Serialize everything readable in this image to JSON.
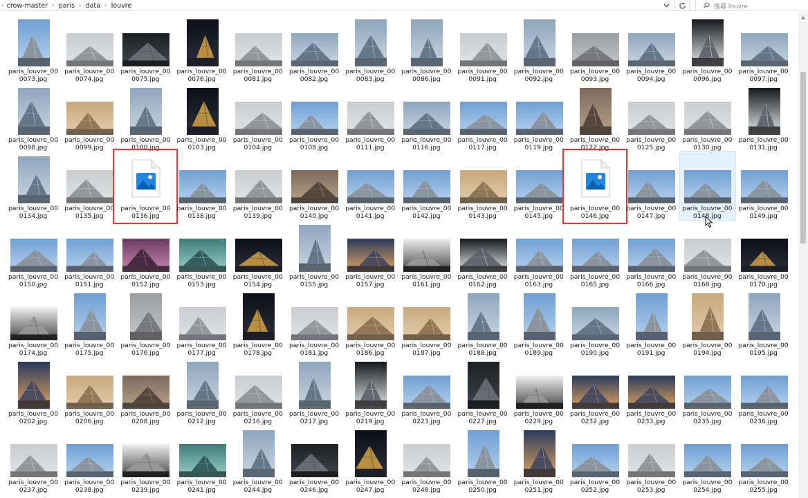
{
  "breadcrumbs": [
    "crow-master",
    "paris",
    "data",
    "louvre"
  ],
  "search": {
    "placeholder": "搜尋 louvre"
  },
  "icons": {
    "lead": "chevron-right-icon",
    "dropdown": "chevron-down-icon",
    "refresh": "refresh-icon",
    "search": "search-icon",
    "file": "image-file-icon",
    "cursor": "mouse-pointer-icon"
  },
  "colors": {
    "highlight_border": "#e03a3a",
    "hover_bg": "#e5f1fb",
    "file_icon_blue": "#1e88e5"
  },
  "rows": [
    [
      {
        "line1": "paris_louvre_00",
        "line2": "0073.jpg",
        "shape": "tall",
        "theme": "sky"
      },
      {
        "line1": "paris_louvre_00",
        "line2": "0074.jpg",
        "shape": "wide",
        "theme": "overcast"
      },
      {
        "line1": "paris_louvre_00",
        "line2": "0075.jpg",
        "shape": "wide",
        "theme": "dark"
      },
      {
        "line1": "paris_louvre_00",
        "line2": "0076.jpg",
        "shape": "tall",
        "theme": "night"
      },
      {
        "line1": "paris_louvre_00",
        "line2": "0081.jpg",
        "shape": "wide",
        "theme": "overcast"
      },
      {
        "line1": "paris_louvre_00",
        "line2": "0082.jpg",
        "shape": "wide",
        "theme": "glass"
      },
      {
        "line1": "paris_louvre_00",
        "line2": "0083.jpg",
        "shape": "tall",
        "theme": "glass"
      },
      {
        "line1": "paris_louvre_00",
        "line2": "0086.jpg",
        "shape": "tall",
        "theme": "glass"
      },
      {
        "line1": "paris_louvre_00",
        "line2": "0091.jpg",
        "shape": "wide",
        "theme": "overcast"
      },
      {
        "line1": "paris_louvre_00",
        "line2": "0092.jpg",
        "shape": "tall",
        "theme": "glass"
      },
      {
        "line1": "paris_louvre_00",
        "line2": "0093.jpg",
        "shape": "wide",
        "theme": "gray"
      },
      {
        "line1": "paris_louvre_00",
        "line2": "0094.jpg",
        "shape": "wide",
        "theme": "glass"
      },
      {
        "line1": "paris_louvre_00",
        "line2": "0096.jpg",
        "shape": "tall",
        "theme": "arch"
      },
      {
        "line1": "paris_louvre_00",
        "line2": "0097.jpg",
        "shape": "wide",
        "theme": "glass"
      }
    ],
    [
      {
        "line1": "paris_louvre_00",
        "line2": "0098.jpg",
        "shape": "tall",
        "theme": "glass"
      },
      {
        "line1": "paris_louvre_00",
        "line2": "0099.jpg",
        "shape": "wide",
        "theme": "warm"
      },
      {
        "line1": "paris_louvre_00",
        "line2": "0100.jpg",
        "shape": "tall",
        "theme": "glass"
      },
      {
        "line1": "paris_louvre_00",
        "line2": "0103.jpg",
        "shape": "tall",
        "theme": "night"
      },
      {
        "line1": "paris_louvre_00",
        "line2": "0104.jpg",
        "shape": "wide",
        "theme": "overcast"
      },
      {
        "line1": "paris_louvre_00",
        "line2": "0108.jpg",
        "shape": "wide",
        "theme": "sky"
      },
      {
        "line1": "paris_louvre_00",
        "line2": "0111.jpg",
        "shape": "wide",
        "theme": "overcast"
      },
      {
        "line1": "paris_louvre_00",
        "line2": "0116.jpg",
        "shape": "wide",
        "theme": "glass"
      },
      {
        "line1": "paris_louvre_00",
        "line2": "0117.jpg",
        "shape": "wide",
        "theme": "sky"
      },
      {
        "line1": "paris_louvre_00",
        "line2": "0119.jpg",
        "shape": "wide",
        "theme": "sky"
      },
      {
        "line1": "paris_louvre_00",
        "line2": "0122.jpg",
        "shape": "tall",
        "theme": "crowd"
      },
      {
        "line1": "paris_louvre_00",
        "line2": "0125.jpg",
        "shape": "wide",
        "theme": "overcast"
      },
      {
        "line1": "paris_louvre_00",
        "line2": "0130.jpg",
        "shape": "wide",
        "theme": "overcast"
      },
      {
        "line1": "paris_louvre_00",
        "line2": "0131.jpg",
        "shape": "tall",
        "theme": "arch"
      }
    ],
    [
      {
        "line1": "paris_louvre_00",
        "line2": "0134.jpg",
        "shape": "tall",
        "theme": "glass"
      },
      {
        "line1": "paris_louvre_00",
        "line2": "0135.jpg",
        "shape": "wide",
        "theme": "overcast"
      },
      {
        "line1": "paris_louvre_00",
        "line2": "0136.jpg",
        "shape": "file",
        "theme": "file",
        "marked": true
      },
      {
        "line1": "paris_louvre_00",
        "line2": "0138.jpg",
        "shape": "wide",
        "theme": "sky"
      },
      {
        "line1": "paris_louvre_00",
        "line2": "0139.jpg",
        "shape": "wide",
        "theme": "overcast"
      },
      {
        "line1": "paris_louvre_00",
        "line2": "0140.jpg",
        "shape": "wide",
        "theme": "crowd"
      },
      {
        "line1": "paris_louvre_00",
        "line2": "0141.jpg",
        "shape": "wide",
        "theme": "sky"
      },
      {
        "line1": "paris_louvre_00",
        "line2": "0142.jpg",
        "shape": "wide",
        "theme": "sky"
      },
      {
        "line1": "paris_louvre_00",
        "line2": "0143.jpg",
        "shape": "wide",
        "theme": "warm"
      },
      {
        "line1": "paris_louvre_00",
        "line2": "0145.jpg",
        "shape": "wide",
        "theme": "sky"
      },
      {
        "line1": "paris_louvre_00",
        "line2": "0146.jpg",
        "shape": "file",
        "theme": "file",
        "marked": true
      },
      {
        "line1": "paris_louvre_00",
        "line2": "0147.jpg",
        "shape": "wide",
        "theme": "sky"
      },
      {
        "line1": "paris_louvre_00",
        "line2": "0148.jpg",
        "shape": "wide",
        "theme": "sky",
        "hover": true
      },
      {
        "line1": "paris_louvre_00",
        "line2": "0149.jpg",
        "shape": "wide",
        "theme": "sky"
      }
    ],
    [
      {
        "line1": "paris_louvre_00",
        "line2": "0150.jpg",
        "shape": "wide",
        "theme": "sky"
      },
      {
        "line1": "paris_louvre_00",
        "line2": "0151.jpg",
        "shape": "wide",
        "theme": "sky"
      },
      {
        "line1": "paris_louvre_00",
        "line2": "0152.jpg",
        "shape": "wide",
        "theme": "purple"
      },
      {
        "line1": "paris_louvre_00",
        "line2": "0153.jpg",
        "shape": "wide",
        "theme": "teal"
      },
      {
        "line1": "paris_louvre_00",
        "line2": "0154.jpg",
        "shape": "wide",
        "theme": "night"
      },
      {
        "line1": "paris_louvre_00",
        "line2": "0155.jpg",
        "shape": "tall",
        "theme": "glass"
      },
      {
        "line1": "paris_louvre_00",
        "line2": "0157.jpg",
        "shape": "wide",
        "theme": "dusk"
      },
      {
        "line1": "paris_louvre_00",
        "line2": "0161.jpg",
        "shape": "wide",
        "theme": "bw"
      },
      {
        "line1": "paris_louvre_00",
        "line2": "0162.jpg",
        "shape": "wide",
        "theme": "arch"
      },
      {
        "line1": "paris_louvre_00",
        "line2": "0163.jpg",
        "shape": "wide",
        "theme": "sky"
      },
      {
        "line1": "paris_louvre_00",
        "line2": "0165.jpg",
        "shape": "wide",
        "theme": "sky"
      },
      {
        "line1": "paris_louvre_00",
        "line2": "0166.jpg",
        "shape": "wide",
        "theme": "sky"
      },
      {
        "line1": "paris_louvre_00",
        "line2": "0168.jpg",
        "shape": "wide",
        "theme": "overcast"
      },
      {
        "line1": "paris_louvre_00",
        "line2": "0170.jpg",
        "shape": "wide",
        "theme": "night"
      }
    ],
    [
      {
        "line1": "paris_louvre_00",
        "line2": "0174.jpg",
        "shape": "wide",
        "theme": "bw"
      },
      {
        "line1": "paris_louvre_00",
        "line2": "0175.jpg",
        "shape": "tall",
        "theme": "sky"
      },
      {
        "line1": "paris_louvre_00",
        "line2": "0176.jpg",
        "shape": "tall",
        "theme": "gray"
      },
      {
        "line1": "paris_louvre_00",
        "line2": "0177.jpg",
        "shape": "wide",
        "theme": "overcast"
      },
      {
        "line1": "paris_louvre_00",
        "line2": "0178.jpg",
        "shape": "tall",
        "theme": "night"
      },
      {
        "line1": "paris_louvre_00",
        "line2": "0181.jpg",
        "shape": "wide",
        "theme": "overcast"
      },
      {
        "line1": "paris_louvre_00",
        "line2": "0186.jpg",
        "shape": "wide",
        "theme": "warm"
      },
      {
        "line1": "paris_louvre_00",
        "line2": "0187.jpg",
        "shape": "wide",
        "theme": "warm"
      },
      {
        "line1": "paris_louvre_00",
        "line2": "0188.jpg",
        "shape": "tall",
        "theme": "glass"
      },
      {
        "line1": "paris_louvre_00",
        "line2": "0189.jpg",
        "shape": "tall",
        "theme": "sky"
      },
      {
        "line1": "paris_louvre_00",
        "line2": "0190.jpg",
        "shape": "wide",
        "theme": "glass"
      },
      {
        "line1": "paris_louvre_00",
        "line2": "0191.jpg",
        "shape": "tall",
        "theme": "sky"
      },
      {
        "line1": "paris_louvre_00",
        "line2": "0194.jpg",
        "shape": "tall",
        "theme": "warm"
      },
      {
        "line1": "paris_louvre_00",
        "line2": "0195.jpg",
        "shape": "tall",
        "theme": "glass"
      }
    ],
    [
      {
        "line1": "paris_louvre_00",
        "line2": "0202.jpg",
        "shape": "tall",
        "theme": "dusk"
      },
      {
        "line1": "paris_louvre_00",
        "line2": "0206.jpg",
        "shape": "wide",
        "theme": "warm"
      },
      {
        "line1": "paris_louvre_00",
        "line2": "0208.jpg",
        "shape": "wide",
        "theme": "crowd"
      },
      {
        "line1": "paris_louvre_00",
        "line2": "0212.jpg",
        "shape": "tall",
        "theme": "glass"
      },
      {
        "line1": "paris_louvre_00",
        "line2": "0216.jpg",
        "shape": "wide",
        "theme": "overcast"
      },
      {
        "line1": "paris_louvre_00",
        "line2": "0217.jpg",
        "shape": "tall",
        "theme": "glass"
      },
      {
        "line1": "paris_louvre_00",
        "line2": "0219.jpg",
        "shape": "tall",
        "theme": "arch"
      },
      {
        "line1": "paris_louvre_00",
        "line2": "0223.jpg",
        "shape": "wide",
        "theme": "sky"
      },
      {
        "line1": "paris_louvre_00",
        "line2": "0227.jpg",
        "shape": "tall",
        "theme": "dark"
      },
      {
        "line1": "paris_louvre_00",
        "line2": "0229.jpg",
        "shape": "wide",
        "theme": "bw"
      },
      {
        "line1": "paris_louvre_00",
        "line2": "0232.jpg",
        "shape": "wide",
        "theme": "dusk"
      },
      {
        "line1": "paris_louvre_00",
        "line2": "0233.jpg",
        "shape": "wide",
        "theme": "dusk"
      },
      {
        "line1": "paris_louvre_00",
        "line2": "0235.jpg",
        "shape": "wide",
        "theme": "sky"
      },
      {
        "line1": "paris_louvre_00",
        "line2": "0236.jpg",
        "shape": "wide",
        "theme": "sky"
      }
    ],
    [
      {
        "line1": "paris_louvre_00",
        "line2": "0237.jpg",
        "shape": "wide",
        "theme": "overcast"
      },
      {
        "line1": "paris_louvre_00",
        "line2": "0238.jpg",
        "shape": "wide",
        "theme": "sky"
      },
      {
        "line1": "paris_louvre_00",
        "line2": "0239.jpg",
        "shape": "wide",
        "theme": "bw"
      },
      {
        "line1": "paris_louvre_00",
        "line2": "0241.jpg",
        "shape": "wide",
        "theme": "teal"
      },
      {
        "line1": "paris_louvre_00",
        "line2": "0244.jpg",
        "shape": "tall",
        "theme": "glass"
      },
      {
        "line1": "paris_louvre_00",
        "line2": "0246.jpg",
        "shape": "wide",
        "theme": "dark"
      },
      {
        "line1": "paris_louvre_00",
        "line2": "0247.jpg",
        "shape": "tall",
        "theme": "night"
      },
      {
        "line1": "paris_louvre_00",
        "line2": "0248.jpg",
        "shape": "wide",
        "theme": "overcast"
      },
      {
        "line1": "paris_louvre_00",
        "line2": "0250.jpg",
        "shape": "tall",
        "theme": "sky"
      },
      {
        "line1": "paris_louvre_00",
        "line2": "0251.jpg",
        "shape": "tall",
        "theme": "dusk"
      },
      {
        "line1": "paris_louvre_00",
        "line2": "0252.jpg",
        "shape": "wide",
        "theme": "sky"
      },
      {
        "line1": "paris_louvre_00",
        "line2": "0253.jpg",
        "shape": "wide",
        "theme": "overcast"
      },
      {
        "line1": "paris_louvre_00",
        "line2": "0254.jpg",
        "shape": "wide",
        "theme": "sky"
      },
      {
        "line1": "paris_louvre_00",
        "line2": "0255.jpg",
        "shape": "wide",
        "theme": "sky"
      }
    ]
  ]
}
